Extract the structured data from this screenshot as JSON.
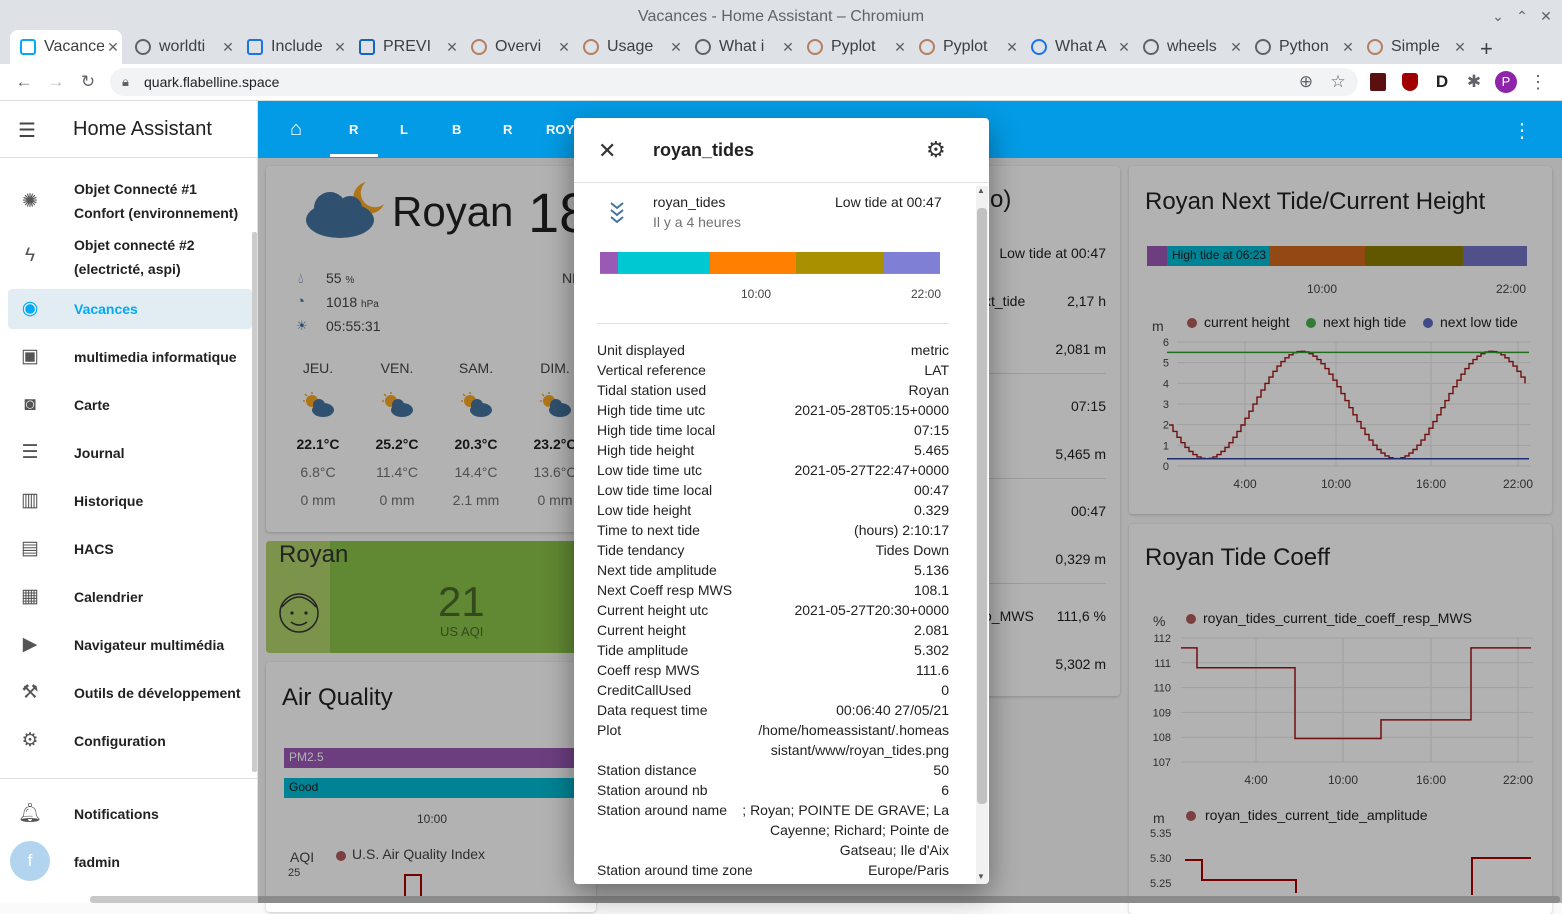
{
  "window": {
    "title": "Vacances - Home Assistant – Chromium"
  },
  "browser": {
    "tabs": [
      {
        "label": "Vacances"
      },
      {
        "label": "worldti"
      },
      {
        "label": "Include"
      },
      {
        "label": "PREVI"
      },
      {
        "label": "Overvi"
      },
      {
        "label": "Usage"
      },
      {
        "label": "What i"
      },
      {
        "label": "Pyplot"
      },
      {
        "label": "Pyplot"
      },
      {
        "label": "What A"
      },
      {
        "label": "wheels"
      },
      {
        "label": "Python"
      },
      {
        "label": "Simple"
      }
    ],
    "url": "quark.flabelline.space",
    "profile_initial": "P"
  },
  "ha": {
    "title": "Home Assistant",
    "sidebar": [
      {
        "label1": "Objet Connecté #1",
        "label2": "Confort (environnement)"
      },
      {
        "label1": "Objet connecté #2",
        "label2": "(electricté, aspi)"
      },
      {
        "label": "Vacances"
      },
      {
        "label": "multimedia informatique"
      },
      {
        "label": "Carte"
      },
      {
        "label": "Journal"
      },
      {
        "label": "Historique"
      },
      {
        "label": "HACS"
      },
      {
        "label": "Calendrier"
      },
      {
        "label": "Navigateur multimédia"
      },
      {
        "label": "Outils de développement"
      },
      {
        "label": "Configuration"
      },
      {
        "label": "Notifications"
      },
      {
        "label": "fadmin",
        "avatar": "f"
      }
    ],
    "view_tabs": [
      "R",
      "L",
      "B",
      "R",
      "ROY"
    ]
  },
  "weather": {
    "city": "Royan",
    "temp": "18",
    "humidity": "55",
    "humidity_unit": "%",
    "pressure": "1018",
    "pressure_unit": "hPa",
    "sunset": "05:55:31",
    "wind": "NN",
    "days": [
      {
        "day": "JEU.",
        "high": "22.1°C",
        "low": "6.8°C",
        "rain": "0 mm"
      },
      {
        "day": "VEN.",
        "high": "25.2°C",
        "low": "11.4°C",
        "rain": "0 mm"
      },
      {
        "day": "SAM.",
        "high": "20.3°C",
        "low": "14.4°C",
        "rain": "2.1 mm"
      },
      {
        "day": "DIM.",
        "high": "23.2°C",
        "low": "13.6°C",
        "rain": "0 mm"
      }
    ]
  },
  "aqi_card": {
    "city": "Royan",
    "value": "21",
    "unit": "US AQI"
  },
  "air_quality": {
    "title": "Air Quality",
    "bar1": "PM2.5",
    "bar2": "Good",
    "tick": "10:00",
    "ylabel": "AQI",
    "legend": "U.S. Air Quality Index",
    "ytick": "25"
  },
  "tide_entities": {
    "title_tail": "o)",
    "rows": [
      {
        "label": "",
        "value": "Low tide at 00:47"
      },
      {
        "label": "xt_tide",
        "value": "2,17 h"
      },
      {
        "label": "",
        "value": "2,081 m"
      },
      {
        "label": "",
        "value": "07:15"
      },
      {
        "label": "",
        "value": "5,465 m"
      },
      {
        "label": "",
        "value": "00:47"
      },
      {
        "label": "",
        "value": "0,329 m"
      },
      {
        "label": "o_MWS",
        "value": "111,6 %"
      },
      {
        "label": "",
        "value": "5,302 m"
      }
    ]
  },
  "next_tide_card": {
    "title": "Royan Next Tide/Current Height",
    "bar_label": "High tide at 06:23",
    "bar_ticks": [
      "10:00",
      "22:00"
    ],
    "chart_data": {
      "type": "line",
      "ylabel": "m",
      "series": [
        {
          "name": "current height"
        },
        {
          "name": "next high tide",
          "value": 5.5
        },
        {
          "name": "next low tide",
          "value": 0.35
        }
      ],
      "x_ticks": [
        "4:00",
        "10:00",
        "16:00",
        "22:00"
      ],
      "y_ticks": [
        0,
        1,
        2,
        3,
        4,
        5,
        6
      ]
    }
  },
  "coeff_card": {
    "title": "Royan Tide Coeff",
    "chart_data": {
      "type": "line",
      "ylabel": "%",
      "series": [
        {
          "name": "royan_tides_current_tide_coeff_resp_MWS"
        }
      ],
      "y_ticks": [
        107,
        108,
        109,
        110,
        111,
        112
      ],
      "x_ticks": [
        "4:00",
        "10:00",
        "16:00",
        "22:00"
      ]
    },
    "chart2": {
      "ylabel": "m",
      "legend": "royan_tides_current_tide_amplitude",
      "y_ticks": [
        "5.35",
        "5.30",
        "5.25"
      ]
    }
  },
  "dialog": {
    "title": "royan_tides",
    "entity_name": "royan_tides",
    "entity_time": "Il y a 4 heures",
    "entity_state": "Low tide at 00:47",
    "timeline_ticks": [
      "10:00",
      "22:00"
    ],
    "colors": {
      "purple": "#9b59b6",
      "cyan": "#00c8d2",
      "orange": "#ff8000",
      "olive": "#a89000",
      "lavender": "#7f7fd5"
    },
    "attributes": [
      {
        "k": "Unit displayed",
        "v": "metric"
      },
      {
        "k": "Vertical reference",
        "v": "LAT"
      },
      {
        "k": "Tidal station used",
        "v": "Royan"
      },
      {
        "k": "High tide time utc",
        "v": "2021-05-28T05:15+0000"
      },
      {
        "k": "High tide time local",
        "v": "07:15"
      },
      {
        "k": "High tide height",
        "v": "5.465"
      },
      {
        "k": "Low tide time utc",
        "v": "2021-05-27T22:47+0000"
      },
      {
        "k": "Low tide time local",
        "v": "00:47"
      },
      {
        "k": "Low tide height",
        "v": "0.329"
      },
      {
        "k": "Time to next tide",
        "v": "(hours) 2:10:17"
      },
      {
        "k": "Tide tendancy",
        "v": "Tides Down"
      },
      {
        "k": "Next tide amplitude",
        "v": "5.136"
      },
      {
        "k": "Next Coeff resp MWS",
        "v": "108.1"
      },
      {
        "k": "Current height utc",
        "v": "2021-05-27T20:30+0000"
      },
      {
        "k": "Current height",
        "v": "2.081"
      },
      {
        "k": "Tide amplitude",
        "v": "5.302"
      },
      {
        "k": "Coeff resp MWS",
        "v": "111.6"
      },
      {
        "k": "CreditCallUsed",
        "v": "0"
      },
      {
        "k": "Data request time",
        "v": "00:06:40 27/05/21"
      },
      {
        "k": "Plot",
        "v1": "/home/homeassistant/.homeas",
        "v2": "sistant/www/royan_tides.png"
      },
      {
        "k": "Station distance",
        "v": "50"
      },
      {
        "k": "Station around nb",
        "v": "6"
      },
      {
        "k": "Station around name",
        "v1": "; Royan; POINTE DE GRAVE; La",
        "v2": "Cayenne; Richard; Pointe de",
        "v3": "Gatseau; Ile d'Aix"
      },
      {
        "k": "Station around time zone",
        "v": "Europe/Paris"
      }
    ]
  }
}
